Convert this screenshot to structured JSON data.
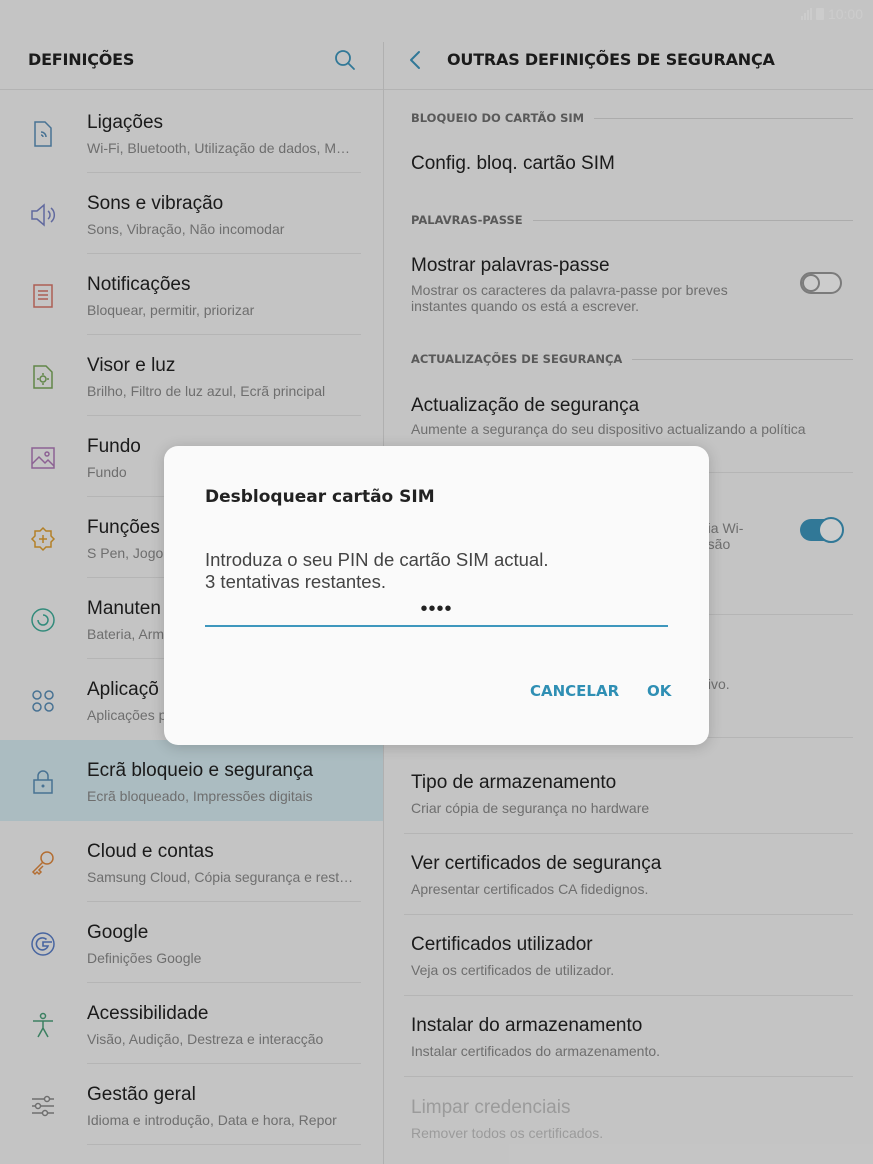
{
  "status": {
    "time": "10:00"
  },
  "left": {
    "title": "DEFINIÇÕES",
    "items": [
      {
        "title": "Ligações",
        "sub": "Wi-Fi, Bluetooth, Utilização de dados, M…",
        "icon": "connections-icon"
      },
      {
        "title": "Sons e vibração",
        "sub": "Sons, Vibração, Não incomodar",
        "icon": "speaker-icon"
      },
      {
        "title": "Notificações",
        "sub": "Bloquear, permitir, priorizar",
        "icon": "notification-icon"
      },
      {
        "title": "Visor e luz",
        "sub": "Brilho, Filtro de luz azul, Ecrã principal",
        "icon": "display-icon"
      },
      {
        "title": "Fundo",
        "sub": "Fundo",
        "icon": "wallpaper-icon"
      },
      {
        "title": "Funções",
        "sub": "S Pen, Jogo",
        "icon": "features-icon"
      },
      {
        "title": "Manuten",
        "sub": "Bateria, Arm",
        "icon": "maintenance-icon"
      },
      {
        "title": "Aplicaçõ",
        "sub": "Aplicações p",
        "icon": "apps-icon"
      },
      {
        "title": "Ecrã bloqueio e segurança",
        "sub": "Ecrã bloqueado, Impressões digitais",
        "icon": "lock-icon"
      },
      {
        "title": "Cloud e contas",
        "sub": "Samsung Cloud, Cópia segurança e rest…",
        "icon": "key-icon"
      },
      {
        "title": "Google",
        "sub": "Definições Google",
        "icon": "google-icon"
      },
      {
        "title": "Acessibilidade",
        "sub": "Visão, Audição, Destreza e interacção",
        "icon": "accessibility-icon"
      },
      {
        "title": "Gestão geral",
        "sub": "Idioma e introdução, Data e hora, Repor",
        "icon": "sliders-icon"
      }
    ]
  },
  "right": {
    "title": "OUTRAS DEFINIÇÕES DE SEGURANÇA",
    "sec_sim": "BLOQUEIO DO CARTÃO SIM",
    "sim_lock": "Config. bloq. cartão SIM",
    "sec_passwords": "PALAVRAS-PASSE",
    "show_pw_title": "Mostrar palavras-passe",
    "show_pw_sub": "Mostrar os caracteres da palavra-passe por breves instantes quando os está a escrever.",
    "sec_updates": "ACTUALIZAÇÕES DE SEGURANÇA",
    "sec_update_title": "Actualização de segurança",
    "sec_update_sub": "Aumente a segurança do seu dispositivo actualizando a política",
    "frag_wifi": "g via Wi-",
    "frag_sao": "os são",
    "frag_ivo": "tivo.",
    "storage_type_title": "Tipo de armazenamento",
    "storage_type_sub": "Criar cópia de segurança no hardware",
    "view_certs_title": "Ver certificados de segurança",
    "view_certs_sub": "Apresentar certificados CA fidedignos.",
    "user_certs_title": "Certificados utilizador",
    "user_certs_sub": "Veja os certificados de utilizador.",
    "install_title": "Instalar do armazenamento",
    "install_sub": "Instalar certificados do armazenamento.",
    "clear_title": "Limpar credenciais",
    "clear_sub": "Remover todos os certificados."
  },
  "dialog": {
    "title": "Desbloquear cartão SIM",
    "message": "Introduza o seu PIN de cartão SIM actual.\n3 tentativas restantes.",
    "pin_value": "••••",
    "cancel": "CANCELAR",
    "ok": "OK"
  },
  "colors": {
    "accent": "#3e97bd",
    "selected_bg": "#d6ecf2"
  }
}
